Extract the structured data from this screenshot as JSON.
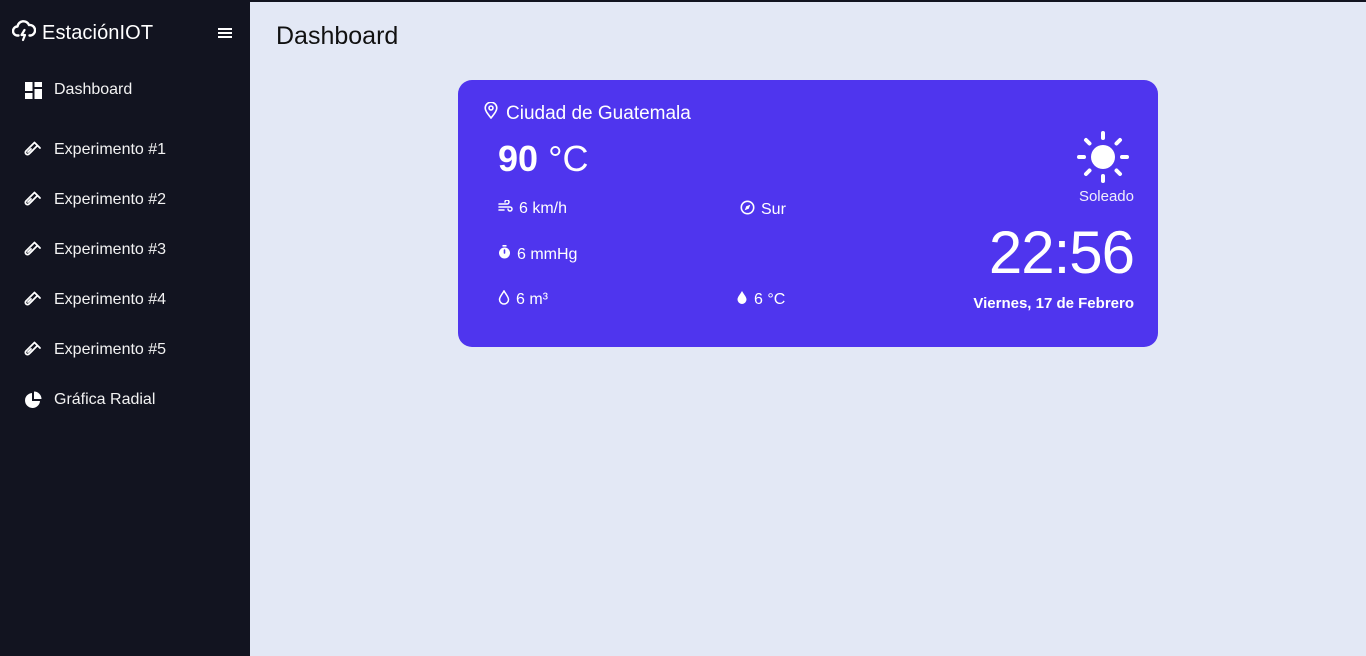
{
  "app": {
    "title": "EstaciónIOT",
    "logo_icon": "cloud-lightning-icon",
    "menu_icon": "hamburger-menu-icon"
  },
  "sidebar": {
    "items": [
      {
        "label": "Dashboard",
        "icon": "dashboard-grid-icon"
      },
      {
        "label": "Experimento #1",
        "icon": "test-tube-icon"
      },
      {
        "label": "Experimento #2",
        "icon": "test-tube-icon"
      },
      {
        "label": "Experimento #3",
        "icon": "test-tube-icon"
      },
      {
        "label": "Experimento #4",
        "icon": "test-tube-icon"
      },
      {
        "label": "Experimento #5",
        "icon": "test-tube-icon"
      },
      {
        "label": "Gráfica Radial",
        "icon": "pie-chart-icon"
      }
    ]
  },
  "main": {
    "page_title": "Dashboard"
  },
  "weather": {
    "location": "Ciudad de Guatemala",
    "temperature": "90",
    "temperature_unit": "°C",
    "wind_speed": "6 km/h",
    "wind_direction": "Sur",
    "pressure": "6 mmHg",
    "volume": "6 m³",
    "dew_point": "6 °C",
    "condition": "Soleado",
    "condition_icon": "sun-icon",
    "time": "22:56",
    "date": "Viernes, 17 de Febrero"
  },
  "colors": {
    "sidebar_bg": "#121420",
    "page_bg": "#e3e8f5",
    "card_bg": "#4f35ee"
  }
}
